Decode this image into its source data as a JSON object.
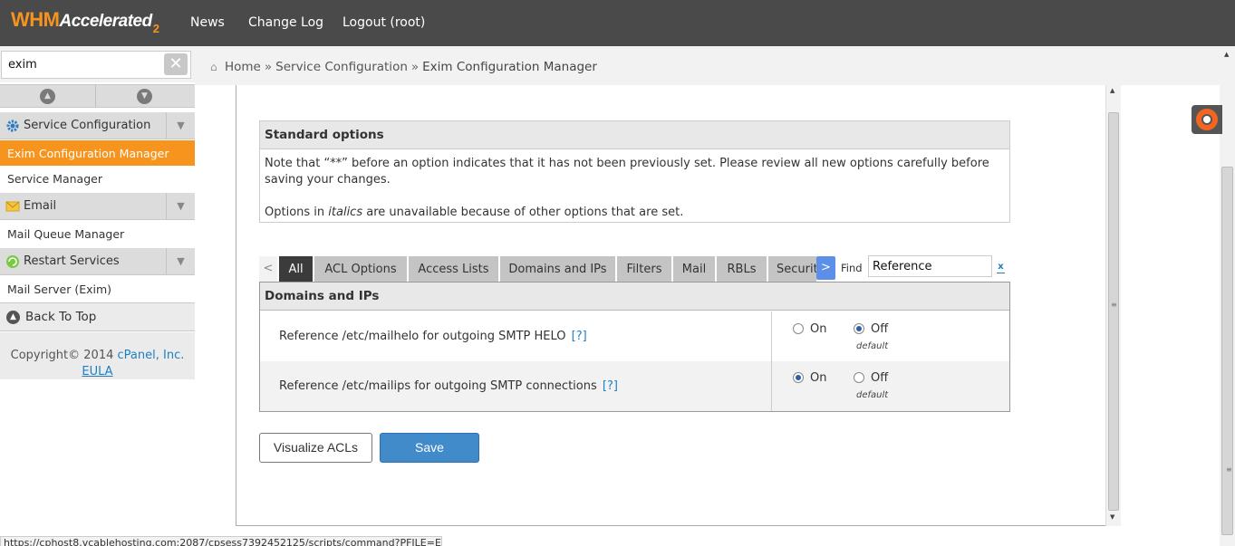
{
  "header": {
    "logo_whm": "WHM",
    "logo_accelerated": "Accelerated",
    "logo_version": "2",
    "nav": [
      "News",
      "Change Log",
      "Logout (root)"
    ]
  },
  "sidebar": {
    "search_value": "exim",
    "sections": [
      {
        "label": "Service Configuration",
        "icon": "gear-icon"
      },
      {
        "label": "Email",
        "icon": "envelope-icon"
      },
      {
        "label": "Restart Services",
        "icon": "refresh-icon"
      }
    ],
    "items": [
      "Exim Configuration Manager",
      "Service Manager",
      "Mail Queue Manager",
      "Mail Server (Exim)"
    ],
    "back_to_top": "Back To Top",
    "copyright_prefix": "Copyright© 2014",
    "copyright_link": "cPanel, Inc.",
    "eula": "EULA"
  },
  "breadcrumb": {
    "home": "Home",
    "section": "Service Configuration",
    "page": "Exim Configuration Manager",
    "separator": "»"
  },
  "standard_options": {
    "title": "Standard options",
    "note": "Note that “**” before an option indicates that it has not been previously set. Please review all new options carefully before saving your changes.",
    "italics_prefix": "Options in ",
    "italics_word": "italics",
    "italics_suffix": " are unavailable because of other options that are set."
  },
  "tabs": {
    "prev": "<",
    "next": ">",
    "items": [
      "All",
      "ACL Options",
      "Access Lists",
      "Domains and IPs",
      "Filters",
      "Mail",
      "RBLs",
      "Securit"
    ],
    "active": "All",
    "find_label": "Find",
    "find_value": "Reference",
    "find_clear": "x"
  },
  "options_table": {
    "title": "Domains and IPs",
    "rows": [
      {
        "label": "Reference /etc/mailhelo for outgoing SMTP HELO",
        "help": "[?]",
        "on": "On",
        "off": "Off",
        "selected": "off",
        "default_label": "default"
      },
      {
        "label": "Reference /etc/mailips for outgoing SMTP connections",
        "help": "[?]",
        "on": "On",
        "off": "Off",
        "selected": "on",
        "default_label": "default"
      }
    ]
  },
  "buttons": {
    "visualize": "Visualize ACLs",
    "save": "Save"
  },
  "status_url": "https://cphost8.vcablehosting.com:2087/cpsess7392452125/scripts/command?PFILE=Email",
  "colors": {
    "accent": "#f7941d",
    "topbar": "#4a4a4a",
    "primary_button": "#428bca",
    "link": "#1f7fc2"
  }
}
